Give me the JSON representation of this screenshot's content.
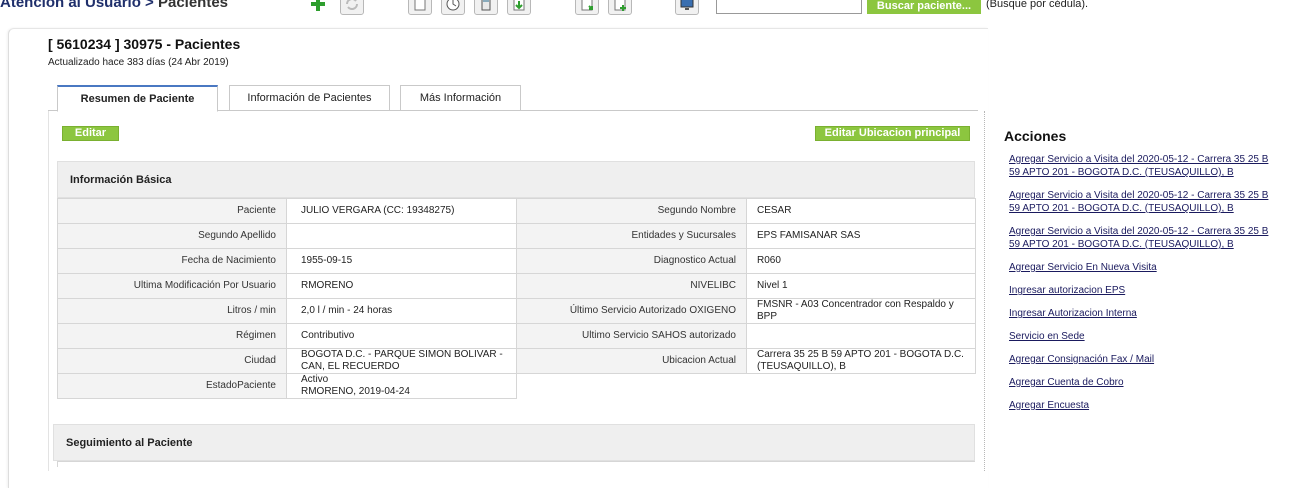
{
  "header": {
    "breadcrumb_parent": "Atención al Usuario",
    "breadcrumb_sep": " > ",
    "breadcrumb_current": "Pacientes",
    "search_placeholder": "",
    "search_button": "Buscar paciente...",
    "search_hint": "(Busque por cédula)."
  },
  "toolbar_icons": [
    "add-icon",
    "refresh-icon",
    "document-icon",
    "clock-icon",
    "calculator-icon",
    "document-download-icon",
    "import-icon",
    "document-add-icon",
    "monitor-icon"
  ],
  "record": {
    "title": "[ 5610234 ] 30975 - Pacientes",
    "updated": "Actualizado hace 383 días (24 Abr 2019)"
  },
  "tabs": [
    {
      "label": "Resumen de Paciente"
    },
    {
      "label": "Información de Pacientes"
    },
    {
      "label": "Más Información"
    }
  ],
  "actions_bar": {
    "edit": "Editar",
    "edit_location": "Editar Ubicacion principal"
  },
  "basic_info": {
    "title": "Información Básica",
    "rows": [
      {
        "l1": "Paciente",
        "v1": "JULIO VERGARA (CC: 19348275)",
        "l2": "Segundo Nombre",
        "v2": "CESAR"
      },
      {
        "l1": "Segundo Apellido",
        "v1": "",
        "l2": "Entidades y Sucursales",
        "v2": "EPS FAMISANAR SAS"
      },
      {
        "l1": "Fecha de Nacimiento",
        "v1": "1955-09-15",
        "l2": "Diagnostico Actual",
        "v2": "R060"
      },
      {
        "l1": "Ultima Modificación Por Usuario",
        "v1": "RMORENO",
        "l2": "NIVELIBC",
        "v2": "Nivel 1"
      },
      {
        "l1": "Litros / min",
        "v1": "2,0 l / min - 24 horas",
        "l2": "Último Servicio Autorizado OXIGENO",
        "v2": "FMSNR - A03 Concentrador con Respaldo y BPP"
      },
      {
        "l1": "Régimen",
        "v1": "Contributivo",
        "l2": "Ultimo Servicio SAHOS autorizado",
        "v2": ""
      },
      {
        "l1": "Ciudad",
        "v1": "BOGOTA D.C. - PARQUE SIMON BOLIVAR - CAN, EL RECUERDO",
        "l2": "Ubicacion Actual",
        "v2": "Carrera 35 25 B 59 APTO 201 - BOGOTA D.C. (TEUSAQUILLO), B"
      }
    ],
    "estado_label": "EstadoPaciente",
    "estado_line1": "Activo",
    "estado_line2": "RMORENO, 2019-04-24"
  },
  "tracking": {
    "title": "Seguimiento al Paciente"
  },
  "sidebar": {
    "title": "Acciones",
    "links": [
      "Agregar Servicio a Visita del 2020-05-12 - Carrera 35 25 B 59 APTO 201 - BOGOTA D.C. (TEUSAQUILLO), B",
      "Agregar Servicio a Visita del 2020-05-12 - Carrera 35 25 B 59 APTO 201 - BOGOTA D.C. (TEUSAQUILLO), B",
      "Agregar Servicio a Visita del 2020-05-12 - Carrera 35 25 B 59 APTO 201 - BOGOTA D.C. (TEUSAQUILLO), B",
      "Agregar Servicio En Nueva Visita",
      "Ingresar autorizacion EPS",
      "Ingresar Autorizacion Interna",
      "Servicio en Sede",
      "Agregar Consignación Fax / Mail",
      "Agregar Cuenta de Cobro",
      "Agregar Encuesta"
    ]
  }
}
